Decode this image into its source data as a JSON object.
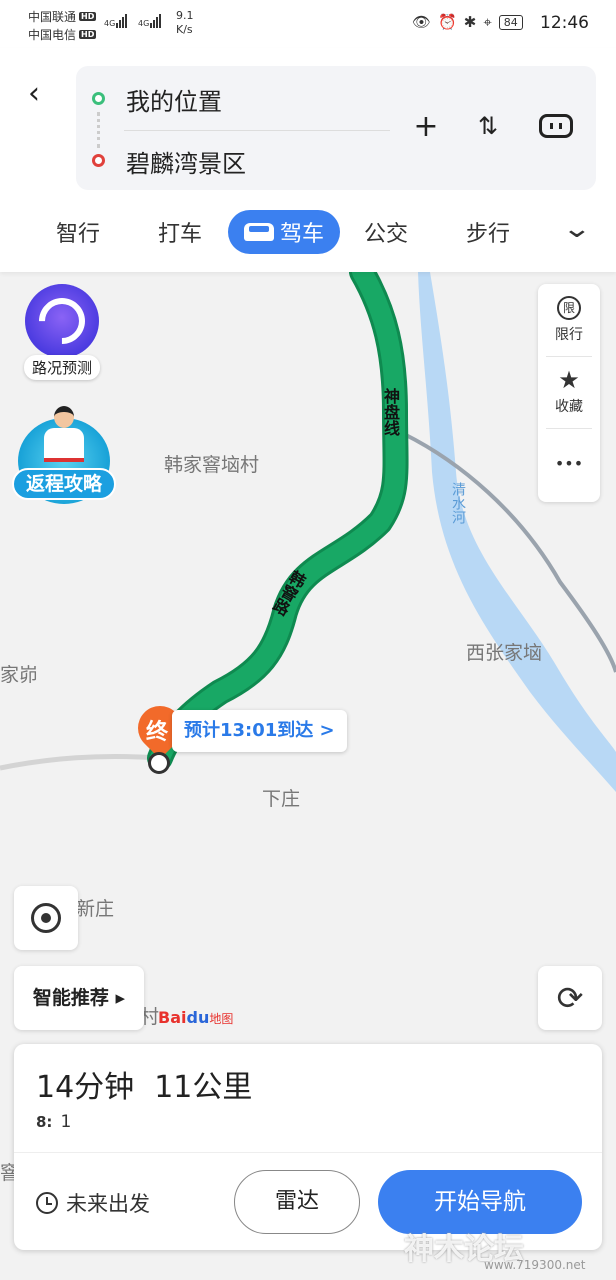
{
  "status_bar": {
    "carrier1": "中国联通",
    "carrier2": "中国电信",
    "hd": "HD",
    "network": "4G",
    "speed_value": "9.1",
    "speed_unit": "K/s",
    "battery": "84",
    "time": "12:46",
    "icons": [
      "eye-icon",
      "alarm-icon",
      "bluetooth-icon",
      "location-icon"
    ]
  },
  "route": {
    "back_icon": "chevron-left-icon",
    "from": "我的位置",
    "to": "碧麟湾景区",
    "add_icon": "plus-icon",
    "swap_icon": "swap-icon",
    "options_icon": "toggle-icon"
  },
  "tabs": {
    "smart": "智行",
    "taxi": "打车",
    "drive": "驾车",
    "bus": "公交",
    "walk": "步行",
    "expand_icon": "chevron-down-icon"
  },
  "map": {
    "places": {
      "village1": "韩家窨垴村",
      "village2": "西张家垴",
      "village3": "家峁",
      "village4": "下庄",
      "village5": "新庄",
      "village6": "村",
      "village7": "窨"
    },
    "roads": {
      "road1": "神盘线",
      "road2": "韩窨路"
    },
    "river": "清水河",
    "traffic_forecast": "路况预测",
    "return_strategy": "返程攻略",
    "limit_label": "限行",
    "limit_icon_text": "限",
    "favorite_label": "收藏",
    "more_label": "•••",
    "end_marker": "终",
    "eta": "预计13:01到达 >",
    "smart_recommend": "智能推荐 ▸",
    "logo_bai": "Bai",
    "logo_du": "du",
    "logo_map": "地图",
    "colors": {
      "route": "#18a865",
      "accent": "#3b80f0",
      "pin": "#f26a2a"
    }
  },
  "summary": {
    "duration": "14分钟",
    "distance": "11公里",
    "traffic_lights": "1",
    "future_departure": "未来出发",
    "radar": "雷达",
    "start_navigation": "开始导航"
  },
  "watermark": {
    "text": "神木论坛",
    "url": "www.719300.net"
  }
}
